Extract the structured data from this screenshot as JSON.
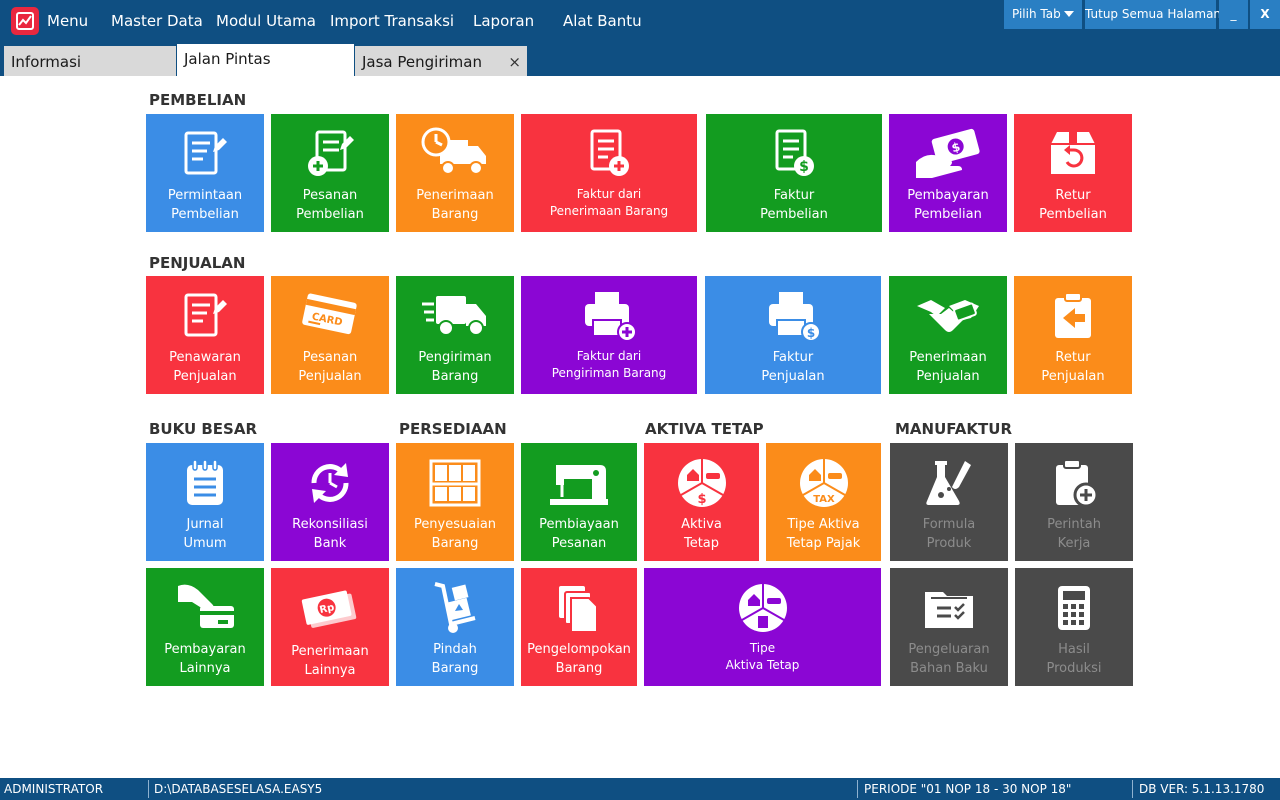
{
  "topbar": {
    "menu_label": "Menu",
    "items": [
      "Master Data",
      "Modul Utama",
      "Import Transaksi",
      "Laporan",
      "Alat Bantu"
    ],
    "pilih_tab": "Pilih Tab",
    "tutup_semua": "Tutup Semua Halaman",
    "minimize": "_",
    "close": "X"
  },
  "tabs": [
    {
      "label": "Informasi"
    },
    {
      "label": "Jalan Pintas"
    },
    {
      "label": "Jasa Pengiriman",
      "close": "×"
    }
  ],
  "sections": {
    "pembelian": "PEMBELIAN",
    "penjualan": "PENJUALAN",
    "buku_besar": "BUKU BESAR",
    "persediaan": "PERSEDIAAN",
    "aktiva_tetap": "AKTIVA TETAP",
    "manufaktur": "MANUFAKTUR"
  },
  "tiles": {
    "permintaan_pembelian": [
      "Permintaan",
      "Pembelian"
    ],
    "pesanan_pembelian": [
      "Pesanan",
      "Pembelian"
    ],
    "penerimaan_barang": [
      "Penerimaan",
      "Barang"
    ],
    "faktur_penerimaan": [
      "Faktur dari",
      "Penerimaan Barang"
    ],
    "faktur_pembelian": [
      "Faktur",
      "Pembelian"
    ],
    "pembayaran_pembelian": [
      "Pembayaran",
      "Pembelian"
    ],
    "retur_pembelian": [
      "Retur",
      "Pembelian"
    ],
    "penawaran_penjualan": [
      "Penawaran",
      "Penjualan"
    ],
    "pesanan_penjualan": [
      "Pesanan",
      "Penjualan"
    ],
    "pengiriman_barang": [
      "Pengiriman",
      "Barang"
    ],
    "faktur_pengiriman": [
      "Faktur dari",
      "Pengiriman Barang"
    ],
    "faktur_penjualan": [
      "Faktur",
      "Penjualan"
    ],
    "penerimaan_penjualan": [
      "Penerimaan",
      "Penjualan"
    ],
    "retur_penjualan": [
      "Retur",
      "Penjualan"
    ],
    "jurnal_umum": [
      "Jurnal",
      "Umum"
    ],
    "rekonsiliasi_bank": [
      "Rekonsiliasi",
      "Bank"
    ],
    "penyesuaian_barang": [
      "Penyesuaian",
      "Barang"
    ],
    "pembiayaan_pesanan": [
      "Pembiayaan",
      "Pesanan"
    ],
    "aktiva_tetap": [
      "Aktiva",
      "Tetap"
    ],
    "tipe_aktiva_pajak": [
      "Tipe Aktiva",
      "Tetap Pajak"
    ],
    "formula_produk": [
      "Formula",
      "Produk"
    ],
    "perintah_kerja": [
      "Perintah",
      "Kerja"
    ],
    "pembayaran_lainnya": [
      "Pembayaran",
      "Lainnya"
    ],
    "penerimaan_lainnya": [
      "Penerimaan",
      "Lainnya"
    ],
    "pindah_barang": [
      "Pindah",
      "Barang"
    ],
    "pengelompokan_barang": [
      "Pengelompokan",
      "Barang"
    ],
    "tipe_aktiva_tetap": [
      "Tipe",
      "Aktiva Tetap"
    ],
    "pengeluaran_bahan_baku": [
      "Pengeluaran",
      "Bahan Baku"
    ],
    "hasil_produksi": [
      "Hasil",
      "Produksi"
    ]
  },
  "icon_text": {
    "card": "CARD",
    "tax": "TAX",
    "rp": "Rp",
    "dollar": "$"
  },
  "status": {
    "user": "ADMINISTRATOR",
    "db_path": "D:\\DATABASESELASA.EASY5",
    "periode": "PERIODE \"01 NOP 18 - 30 NOP 18\"",
    "db_ver": "DB VER: 5.1.13.1780"
  },
  "colors": {
    "header": "#0f4f82",
    "blue": "#3b8de6",
    "green": "#139c20",
    "orange": "#fb8c1a",
    "red": "#f8333f",
    "purple": "#8b06d4",
    "gray": "#4a4a4a"
  }
}
